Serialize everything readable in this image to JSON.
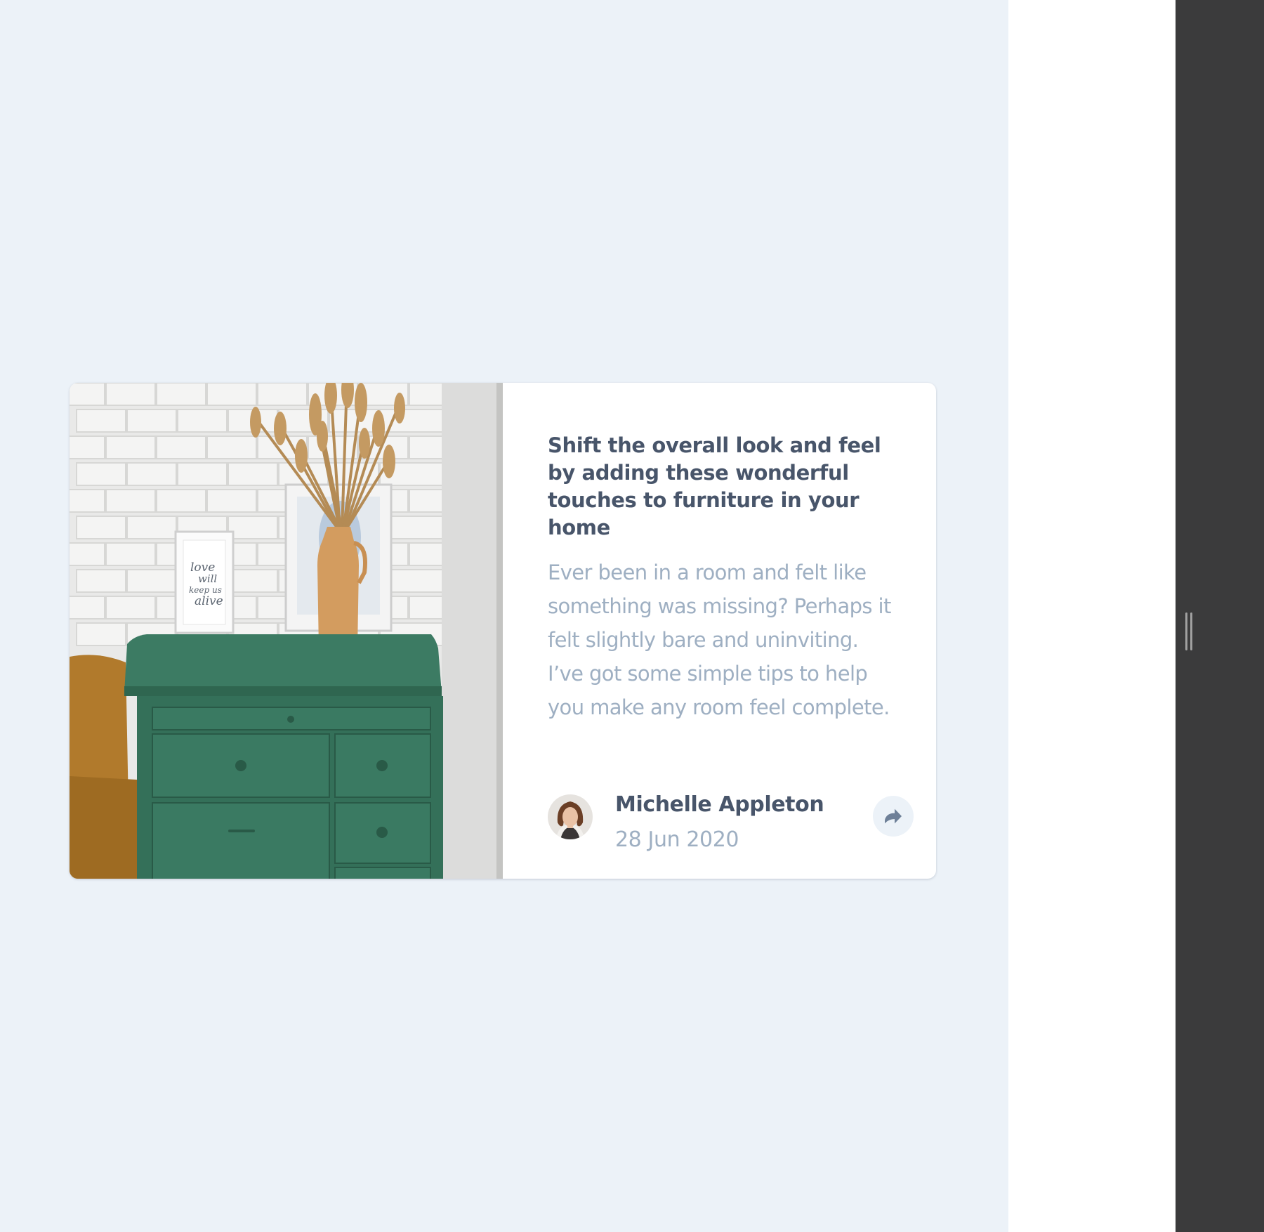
{
  "card": {
    "headline": "Shift the overall look and feel by adding these wonderful touches to furniture in your home",
    "excerpt": "Ever been in a room and felt like something was missing? Perhaps it felt slightly bare and uninviting. I’ve got some simple tips to help you make any room feel complete.",
    "image": {
      "frame_text": [
        "love",
        "will",
        "keep us",
        "alive"
      ]
    },
    "author": {
      "name": "Michelle Appleton",
      "date": "28 Jun 2020"
    },
    "share_icon": "share-arrow-icon"
  },
  "colors": {
    "background": "#ecf2f8",
    "card": "#ffffff",
    "heading": "#48556a",
    "body_text": "#9eafc2",
    "share_bg": "#ecf2f8",
    "side_panel": "#3b3b3c"
  }
}
